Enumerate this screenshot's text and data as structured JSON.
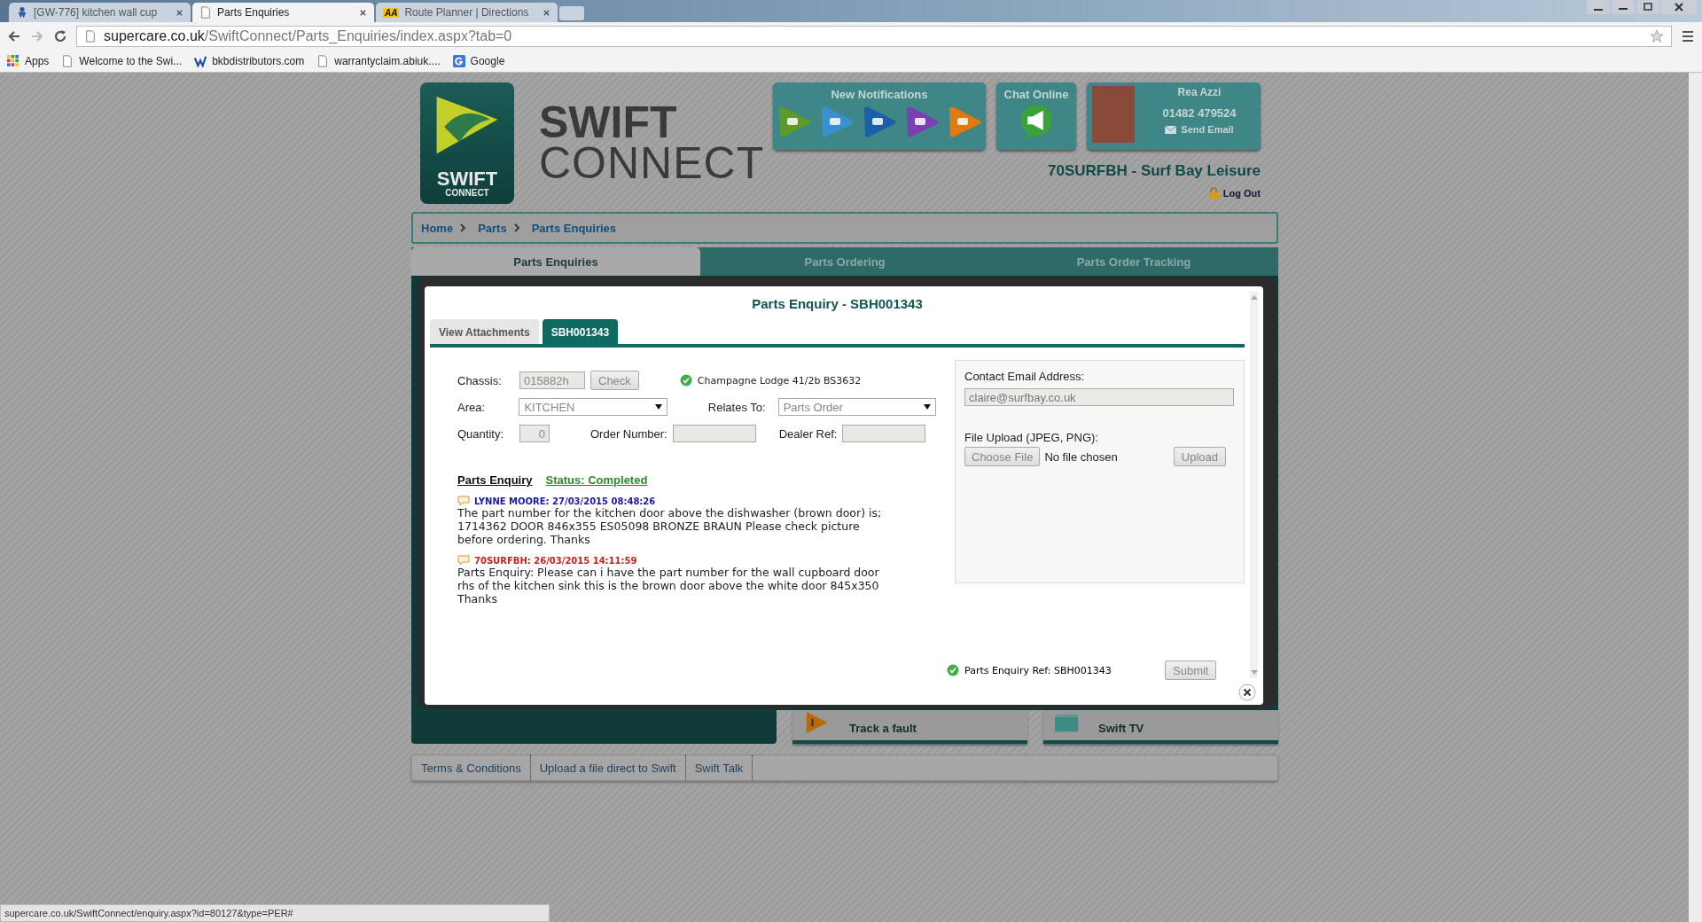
{
  "browser": {
    "tabs": [
      {
        "title": "[GW-776] kitchen wall cup",
        "selected": false
      },
      {
        "title": "Parts Enquiries",
        "selected": true
      },
      {
        "title": "Route Planner | Directions",
        "selected": false
      }
    ],
    "aa_badge": "AA",
    "address": {
      "host": "supercare.co.uk",
      "path": "/SwiftConnect/Parts_Enquiries/index.aspx?tab=0"
    },
    "bookmarks": [
      "Apps",
      "Welcome to the Swi...",
      "bkbdistributors.com",
      "warrantyclaim.abiuk....",
      "Google"
    ],
    "status_url": "supercare.co.uk/SwiftConnect/enquiry.aspx?id=80127&type=PER#"
  },
  "header": {
    "logo_top": "SWIFT",
    "logo_bottom": "CONNECT",
    "brand_top": "SWIFT",
    "brand_bottom": "CONNECT",
    "notifications_title": "New Notifications",
    "chat_title": "Chat Online",
    "user": {
      "name": "Rea Azzi",
      "phone": "01482 479524",
      "send_email": "Send Email"
    },
    "dealer": "70SURFBH - Surf Bay Leisure",
    "logout": "Log Out"
  },
  "breadcrumbs": [
    "Home",
    "Parts",
    "Parts Enquiries"
  ],
  "section_tabs": [
    {
      "label": "Parts Enquiries",
      "selected": true
    },
    {
      "label": "Parts Ordering",
      "selected": false
    },
    {
      "label": "Parts Order Tracking",
      "selected": false
    }
  ],
  "tiles": [
    "Track a fault",
    "Swift TV"
  ],
  "footer_links": [
    "Terms & Conditions",
    "Upload a file direct to Swift",
    "Swift Talk"
  ],
  "modal": {
    "title": "Parts Enquiry - SBH001343",
    "tabs": [
      {
        "label": "View Attachments",
        "selected": false
      },
      {
        "label": "SBH001343",
        "selected": true
      }
    ],
    "chassis": {
      "label": "Chassis:",
      "value": "015882h",
      "button": "Check",
      "result": "Champagne Lodge 41/2b BS3632"
    },
    "area": {
      "label": "Area:",
      "value": "KITCHEN"
    },
    "relates_to": {
      "label": "Relates To:",
      "value": "Parts Order"
    },
    "quantity": {
      "label": "Quantity:",
      "value": "0"
    },
    "order_number": {
      "label": "Order Number:"
    },
    "dealer_ref": {
      "label": "Dealer Ref:"
    },
    "enquiry_heading": "Parts Enquiry",
    "status": "Status: Completed",
    "messages": [
      {
        "author": "LYNNE MOORE: 27/03/2015 08:48:26",
        "color": "#1a1aa0",
        "body": "The part number for the kitchen door above the dishwasher (brown door) is; 1714362 DOOR 846x355 ES05098 BRONZE BRAUN Please check picture before ordering. Thanks"
      },
      {
        "author": "70SURFBH: 26/03/2015 14:11:59",
        "color": "#cc2020",
        "body": "Parts Enquiry: Please can i have the part number for the wall cupboard door rhs of the kitchen sink this is the brown door above the white door 845x350 Thanks"
      }
    ],
    "email": {
      "label": "Contact Email Address:",
      "value": "claire@surfbay.co.uk"
    },
    "upload": {
      "label": "File Upload (JPEG, PNG):",
      "choose": "Choose File",
      "no_file": "No file chosen",
      "button": "Upload"
    },
    "ref": "Parts Enquiry Ref: SBH001343",
    "submit": "Submit"
  }
}
